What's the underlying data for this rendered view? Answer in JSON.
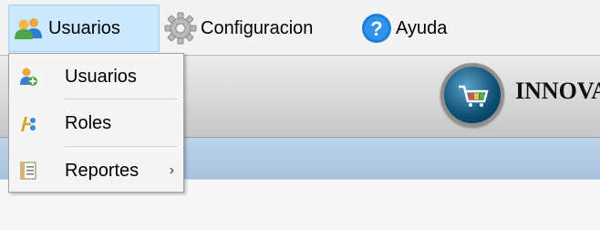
{
  "menubar": {
    "items": [
      {
        "label": "Usuarios",
        "icon": "users-icon",
        "active": true
      },
      {
        "label": "Configuracion",
        "icon": "gear-icon"
      },
      {
        "label": "Ayuda",
        "icon": "help-icon"
      }
    ]
  },
  "dropdown": {
    "items": [
      {
        "label": "Usuarios",
        "icon": "user-add-icon"
      },
      {
        "label": "Roles",
        "icon": "roles-icon"
      },
      {
        "label": "Reportes",
        "icon": "report-icon",
        "submenu_arrow": "›"
      }
    ]
  },
  "brand": {
    "name": "INNOVA"
  },
  "colors": {
    "menu_active_bg": "#cce8ff",
    "menu_active_border": "#99d1ff",
    "blue_band": "#b7cde6",
    "help_blue": "#1e7fd6"
  }
}
